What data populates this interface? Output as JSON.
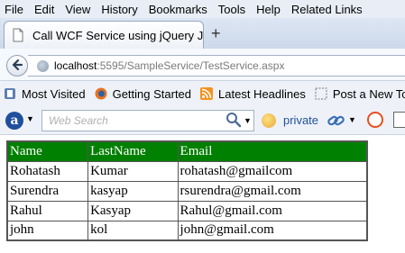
{
  "menu": [
    "File",
    "Edit",
    "View",
    "History",
    "Bookmarks",
    "Tools",
    "Help",
    "Related Links"
  ],
  "tab": {
    "title": "Call WCF Service using jQuery JSO..."
  },
  "new_tab_symbol": "+",
  "address": {
    "host": "localhost",
    "rest": ":5595/SampleService/TestService.aspx"
  },
  "bookmarks": [
    {
      "label": "Most Visited",
      "icon": "bookmarks-icon"
    },
    {
      "label": "Getting Started",
      "icon": "firefox-icon"
    },
    {
      "label": "Latest Headlines",
      "icon": "rss-icon"
    },
    {
      "label": "Post a New Topic",
      "icon": "page-icon"
    }
  ],
  "search": {
    "placeholder": "Web Search",
    "private_label": "private"
  },
  "table": {
    "headers": [
      "Name",
      "LastName",
      "Email"
    ],
    "rows": [
      [
        "Rohatash",
        "Kumar",
        "rohatash@gmailcom"
      ],
      [
        "Surendra",
        "kasyap",
        "rsurendra@gmail.com"
      ],
      [
        "Rahul",
        "Kasyap",
        "Rahul@gmail.com"
      ],
      [
        "john",
        "kol",
        "john@gmail.com"
      ]
    ]
  },
  "colors": {
    "header_bg": "#008000",
    "header_text": "#ffffff"
  }
}
